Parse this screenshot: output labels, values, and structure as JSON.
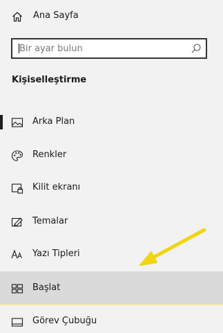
{
  "home": {
    "label": "Ana Sayfa",
    "icon": "home-icon"
  },
  "search": {
    "placeholder": "Bir ayar bulun",
    "icon": "search-icon"
  },
  "section": {
    "title": "Kişiselleştirme"
  },
  "nav": {
    "items": [
      {
        "label": "Arka Plan",
        "icon": "picture-icon"
      },
      {
        "label": "Renkler",
        "icon": "palette-icon"
      },
      {
        "label": "Kilit ekranı",
        "icon": "lock-screen-icon"
      },
      {
        "label": "Temalar",
        "icon": "theme-brush-icon"
      },
      {
        "label": "Yazı Tipleri",
        "icon": "font-icon"
      },
      {
        "label": "Başlat",
        "icon": "start-layout-icon"
      },
      {
        "label": "Görev Çubuğu",
        "icon": "taskbar-icon"
      }
    ]
  },
  "annotation": {
    "arrow_color": "#f2d40f",
    "icon": "yellow-arrow-icon"
  },
  "colors": {
    "background": "#f2f2f2",
    "hover": "#dadada",
    "accent_underline": "#f6e8a6"
  }
}
